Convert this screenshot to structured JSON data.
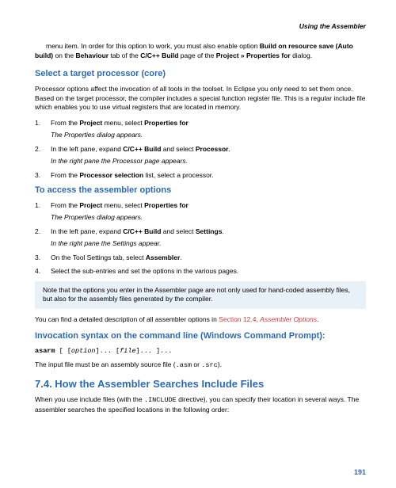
{
  "header": {
    "title": "Using the Assembler"
  },
  "intro": {
    "pre1": "menu item. In order for this option to work, you must also enable option ",
    "b1": "Build on resource save (Auto build)",
    "mid1": " on the ",
    "b2": "Behaviour",
    "mid2": " tab of the ",
    "b3": "C/C++ Build",
    "mid3": " page of the ",
    "b4": "Project » Properties for",
    "end": " dialog."
  },
  "sec1": {
    "heading": "Select a target processor (core)",
    "para": "Processor options affect the invocation of all tools in the toolset. In Eclipse you only need to set them once. Based on the target processor, the compiler includes a special function register file. This is a regular include file which enables you to use virtual registers that are located in memory.",
    "li1_pre": "From the ",
    "li1_b1": "Project",
    "li1_mid": " menu, select ",
    "li1_b2": "Properties for",
    "li1_sub": "The Properties dialog appears.",
    "li2_pre": "In the left pane, expand ",
    "li2_b1": "C/C++ Build",
    "li2_mid": " and select ",
    "li2_b2": "Processor",
    "li2_end": ".",
    "li2_sub": "In the right pane the Processor page appears.",
    "li3_pre": "From the ",
    "li3_b1": "Processor selection",
    "li3_end": " list, select a processor."
  },
  "sec2": {
    "heading": "To access the assembler options",
    "li1_pre": "From the ",
    "li1_b1": "Project",
    "li1_mid": " menu, select ",
    "li1_b2": "Properties for",
    "li1_sub": "The Properties dialog appears.",
    "li2_pre": "In the left pane, expand ",
    "li2_b1": "C/C++ Build",
    "li2_mid": " and select ",
    "li2_b2": "Settings",
    "li2_end": ".",
    "li2_sub": "In the right pane the Settings appear.",
    "li3_pre": "On the Tool Settings tab, select ",
    "li3_b1": "Assembler",
    "li3_end": ".",
    "li4": "Select the sub-entries and set the options in the various pages."
  },
  "note": "Note that the options you enter in the Assembler page are not only used for hand-coded assembly files, but also for the assembly files generated by the compiler.",
  "detail": {
    "pre": "You can find a detailed description of all assembler options in ",
    "link1": "Section 12.4, ",
    "link2": "Assembler Options",
    "end": "."
  },
  "sec3": {
    "heading": "Invocation syntax on the command line (Windows Command Prompt):",
    "cmd_bold": "asarm",
    "cmd_sp1": " [ [",
    "cmd_it1": "option",
    "cmd_sp2": "]... [",
    "cmd_it2": "file",
    "cmd_sp3": "]... ]...",
    "input_pre": "The input file must be an assembly source file (",
    "input_m1": ".asm",
    "input_mid": " or ",
    "input_m2": ".src",
    "input_end": ")."
  },
  "sec4": {
    "heading": "7.4. How the Assembler Searches Include Files",
    "para_pre": "When you use include files (with the ",
    "para_m1": ".INCLUDE",
    "para_end": " directive), you can specify their location in several ways. The assembler searches the specified locations in the following order:"
  },
  "pagenum": "191"
}
